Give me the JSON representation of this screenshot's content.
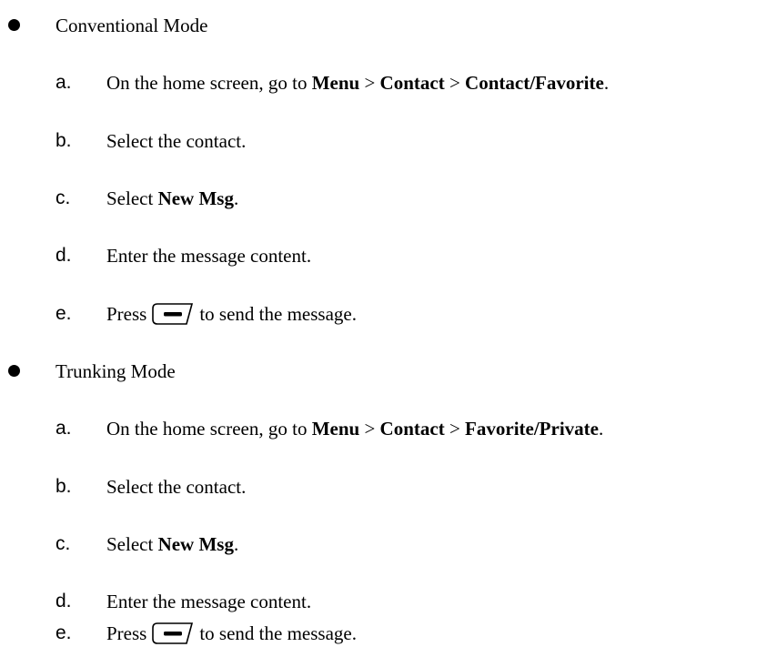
{
  "sections": [
    {
      "title": "Conventional Mode",
      "steps": [
        {
          "letter": "a.",
          "prefix": "On the home screen, go to ",
          "menu": "Menu",
          "sep1": " > ",
          "contact": "Contact",
          "sep2": " > ",
          "target": "Contact/Favorite",
          "suffix": "."
        },
        {
          "letter": "b.",
          "text": "Select the contact."
        },
        {
          "letter": "c.",
          "prefix": "Select ",
          "bold": "New Msg",
          "suffix": "."
        },
        {
          "letter": "d.",
          "text": "Enter the message content."
        },
        {
          "letter": "e.",
          "prefix": "Press",
          "key_icon": "minus-key-icon",
          "suffix": "to send the message."
        }
      ]
    },
    {
      "title": "Trunking Mode",
      "steps": [
        {
          "letter": "a.",
          "prefix": "On the home screen, go to ",
          "menu": "Menu",
          "sep1": " > ",
          "contact": "Contact",
          "sep2": " > ",
          "target": "Favorite/Private",
          "suffix": "."
        },
        {
          "letter": "b.",
          "text": "Select the contact."
        },
        {
          "letter": "c.",
          "prefix": "Select ",
          "bold": "New Msg",
          "suffix": "."
        },
        {
          "letter": "d.",
          "text": "Enter the message content."
        },
        {
          "letter": "e.",
          "prefix": "Press",
          "key_icon": "minus-key-icon",
          "suffix": "to send the message."
        }
      ]
    }
  ]
}
